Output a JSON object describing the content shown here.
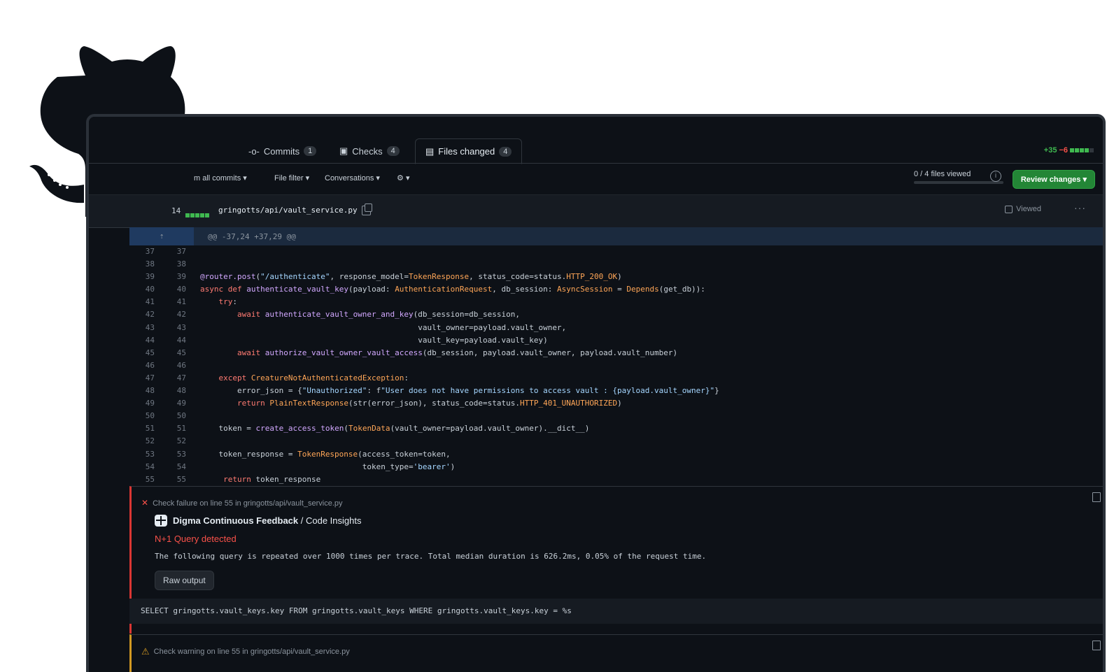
{
  "tabs": [
    {
      "label": "Commits",
      "count": "1"
    },
    {
      "label": "Checks",
      "count": "4"
    },
    {
      "label": "Files changed",
      "count": "4"
    }
  ],
  "diffstat": {
    "additions": "+35",
    "deletions": "−6"
  },
  "toolbar": {
    "commits_filter": "m all commits ▾",
    "file_filter": "File filter ▾",
    "conversations": "Conversations ▾",
    "settings_caret": "▾",
    "files_viewed": "0 / 4 files viewed",
    "files_viewed_fraction": 0,
    "review_button": "Review changes ▾"
  },
  "file": {
    "changes": "14",
    "path": "gringotts/api/vault_service.py",
    "viewed_label": "Viewed"
  },
  "hunk_header": "@@ -37,24 +37,29 @@",
  "code_lines": [
    {
      "o": "37",
      "n": "37",
      "t": ""
    },
    {
      "o": "38",
      "n": "38",
      "t": ""
    },
    {
      "o": "39",
      "n": "39",
      "t": "@router.post(\"/authenticate\", response_model=TokenResponse, status_code=status.HTTP_200_OK)"
    },
    {
      "o": "40",
      "n": "40",
      "t": "async def authenticate_vault_key(payload: AuthenticationRequest, db_session: AsyncSession = Depends(get_db)):"
    },
    {
      "o": "41",
      "n": "41",
      "t": "    try:"
    },
    {
      "o": "42",
      "n": "42",
      "t": "        await authenticate_vault_owner_and_key(db_session=db_session,"
    },
    {
      "o": "43",
      "n": "43",
      "t": "                                               vault_owner=payload.vault_owner,"
    },
    {
      "o": "44",
      "n": "44",
      "t": "                                               vault_key=payload.vault_key)"
    },
    {
      "o": "45",
      "n": "45",
      "t": "        await authorize_vault_owner_vault_access(db_session, payload.vault_owner, payload.vault_number)"
    },
    {
      "o": "46",
      "n": "46",
      "t": ""
    },
    {
      "o": "47",
      "n": "47",
      "t": "    except CreatureNotAuthenticatedException:"
    },
    {
      "o": "48",
      "n": "48",
      "t": "        error_json = {\"Unauthorized\": f\"User does not have permissions to access vault : {payload.vault_owner}\"}"
    },
    {
      "o": "49",
      "n": "49",
      "t": "        return PlainTextResponse(str(error_json), status_code=status.HTTP_401_UNAUTHORIZED)"
    },
    {
      "o": "50",
      "n": "50",
      "t": ""
    },
    {
      "o": "51",
      "n": "51",
      "t": "    token = create_access_token(TokenData(vault_owner=payload.vault_owner).__dict__)"
    },
    {
      "o": "52",
      "n": "52",
      "t": ""
    },
    {
      "o": "53",
      "n": "53",
      "t": "    token_response = TokenResponse(access_token=token,"
    },
    {
      "o": "54",
      "n": "54",
      "t": "                                   token_type='bearer')"
    },
    {
      "o": "55",
      "n": "55",
      "t": "     return token_response"
    }
  ],
  "annotation": {
    "title": "Check failure on line 55 in gringotts/api/vault_service.py",
    "app_name": "Digma Continuous Feedback",
    "app_section": " / Code Insights",
    "error": "N+1 Query detected",
    "message": "The following query is repeated over 1000 times per trace. Total median duration is 626.2ms, 0.05% of the request time.",
    "raw_button": "Raw output"
  },
  "sql": "SELECT gringotts.vault_keys.key FROM gringotts.vault_keys WHERE gringotts.vault_keys.key = %s",
  "warning": {
    "title": "Check warning on line 55 in gringotts/api/vault_service.py"
  },
  "colors": {
    "add": "#3fb950",
    "del": "#f85149",
    "review_btn": "#238636",
    "warn": "#d29922"
  }
}
